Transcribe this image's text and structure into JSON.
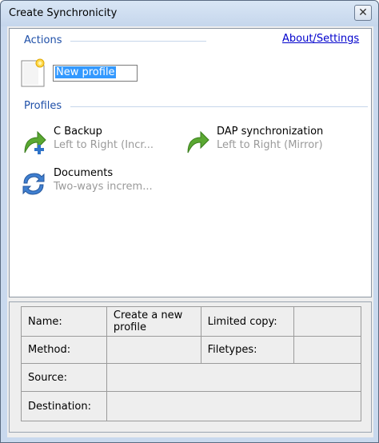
{
  "window": {
    "title": "Create Synchronicity",
    "close_symbol": "✕"
  },
  "actions": {
    "label": "Actions",
    "about_link": "About/Settings",
    "new_profile_value": "New profile",
    "new_profile_icon": "new-document-icon"
  },
  "profiles": {
    "label": "Profiles",
    "items": [
      {
        "name": "C Backup",
        "description": "Left to Right (Incr...",
        "icon": "arrow-plus-icon"
      },
      {
        "name": "DAP synchronization",
        "description": "Left to Right (Mirror)",
        "icon": "arrow-right-icon"
      },
      {
        "name": "Documents",
        "description": "Two-ways increm...",
        "icon": "two-way-sync-icon"
      }
    ]
  },
  "details": {
    "name_label": "Name:",
    "name_value": "Create a new profile",
    "limited_copy_label": "Limited copy:",
    "limited_copy_value": "",
    "method_label": "Method:",
    "method_value": "",
    "filetypes_label": "Filetypes:",
    "filetypes_value": "",
    "source_label": "Source:",
    "source_value": "",
    "destination_label": "Destination:",
    "destination_value": ""
  },
  "colors": {
    "section_label": "#1e4fa8",
    "link": "#0000cc",
    "selection": "#3399ff",
    "description_gray": "#9a9a9a",
    "arrow_green": "#5aa832",
    "sync_blue": "#3f7fd0"
  }
}
